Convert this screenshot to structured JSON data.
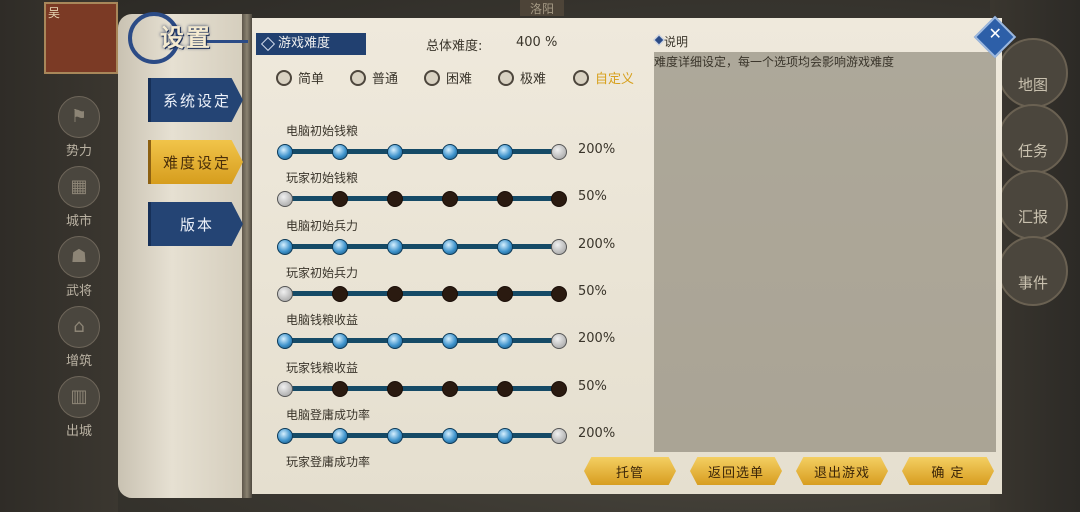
{
  "background": {
    "top_city": "洛阳",
    "avatar_tag": "吴",
    "left_menu": [
      "势力",
      "城市",
      "武将",
      "增筑",
      "出城"
    ],
    "right_menu": [
      "地图",
      "任务",
      "汇报",
      "事件"
    ]
  },
  "dialog": {
    "title": "设置",
    "tabs": [
      {
        "label": "系统设定"
      },
      {
        "label": "难度设定"
      },
      {
        "label": "版本"
      }
    ],
    "section_label": "游戏难度",
    "total_label": "总体难度:",
    "total_value": "400 %",
    "presets": [
      "简单",
      "普通",
      "困难",
      "极难",
      "自定义"
    ],
    "selected_preset": "自定义",
    "sliders": [
      {
        "label": "电脑初始钱粮",
        "value": "200%",
        "level": 6
      },
      {
        "label": "玩家初始钱粮",
        "value": "50%",
        "level": 1
      },
      {
        "label": "电脑初始兵力",
        "value": "200%",
        "level": 6
      },
      {
        "label": "玩家初始兵力",
        "value": "50%",
        "level": 1
      },
      {
        "label": "电脑钱粮收益",
        "value": "200%",
        "level": 6
      },
      {
        "label": "玩家钱粮收益",
        "value": "50%",
        "level": 1
      },
      {
        "label": "电脑登庸成功率",
        "value": "200%",
        "level": 6
      },
      {
        "label": "玩家登庸成功率",
        "value": "",
        "level": null
      }
    ],
    "desc_title": "说明",
    "desc_text": "难度详细设定，每一个选项均会影响游戏难度",
    "buttons": [
      "托管",
      "返回选单",
      "退出游戏",
      "确 定"
    ]
  },
  "colors": {
    "accent_gold": "#d7a01c",
    "tab_blue": "#244474",
    "track": "#154a66"
  }
}
